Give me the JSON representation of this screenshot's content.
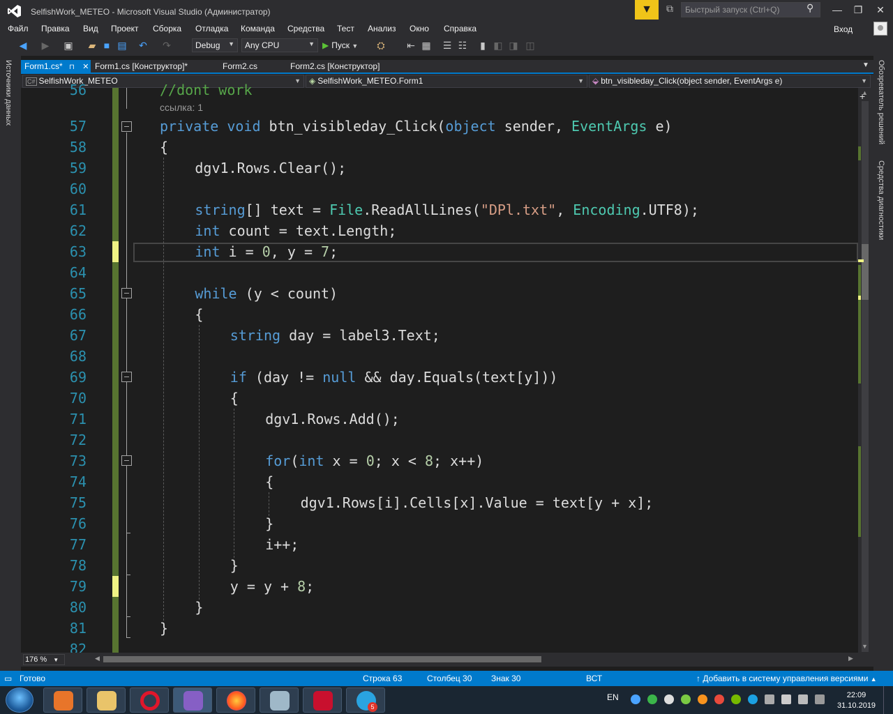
{
  "window": {
    "title": "SelfishWork_METEO - Microsoft Visual Studio  (Администратор)",
    "quick_launch_placeholder": "Быстрый запуск (Ctrl+Q)",
    "sign_in": "Вход"
  },
  "menu": [
    "Файл",
    "Правка",
    "Вид",
    "Проект",
    "Сборка",
    "Отладка",
    "Команда",
    "Средства",
    "Тест",
    "Анализ",
    "Окно",
    "Справка"
  ],
  "toolbar": {
    "config": "Debug",
    "platform": "Any CPU",
    "run": "Пуск"
  },
  "side_panels": {
    "left": "Источники данных",
    "right_top": "Обозреватель решений",
    "right_bottom": "Средства диагностики"
  },
  "tabs": [
    {
      "label": "Form1.cs*",
      "pin": "⊓",
      "close": "✕",
      "active": true
    },
    {
      "label": "Form1.cs [Конструктор]*",
      "active": false
    },
    {
      "label": "Form2.cs",
      "active": false
    },
    {
      "label": "Form2.cs [Конструктор]",
      "active": false
    }
  ],
  "navigation": {
    "project": "SelfishWork_METEO",
    "class": "SelfishWork_METEO.Form1",
    "member": "btn_visibleday_Click(object sender, EventArgs e)"
  },
  "editor": {
    "reference_hint": "ссылка: 1",
    "lines": [
      {
        "n": "56",
        "text": "//dont work"
      },
      {
        "n": "57",
        "text": "private void btn_visibleday_Click(object sender, EventArgs e)"
      },
      {
        "n": "58",
        "text": "{"
      },
      {
        "n": "59",
        "text": "dgv1.Rows.Clear();"
      },
      {
        "n": "60",
        "text": ""
      },
      {
        "n": "61",
        "text": "string[] text = File.ReadAllLines(\"DPl.txt\", Encoding.UTF8);"
      },
      {
        "n": "62",
        "text": "int count = text.Length;"
      },
      {
        "n": "63",
        "text": "int i = 0, y = 7;"
      },
      {
        "n": "64",
        "text": ""
      },
      {
        "n": "65",
        "text": "while (y < count)"
      },
      {
        "n": "66",
        "text": "{"
      },
      {
        "n": "67",
        "text": "string day = label3.Text;"
      },
      {
        "n": "68",
        "text": ""
      },
      {
        "n": "69",
        "text": "if (day != null && day.Equals(text[y]))"
      },
      {
        "n": "70",
        "text": "{"
      },
      {
        "n": "71",
        "text": "dgv1.Rows.Add();"
      },
      {
        "n": "72",
        "text": ""
      },
      {
        "n": "73",
        "text": "for(int x = 0; x < 8; x++)"
      },
      {
        "n": "74",
        "text": "{"
      },
      {
        "n": "75",
        "text": "dgv1.Rows[i].Cells[x].Value = text[y + x];"
      },
      {
        "n": "76",
        "text": "}"
      },
      {
        "n": "77",
        "text": "i++;"
      },
      {
        "n": "78",
        "text": "}"
      },
      {
        "n": "79",
        "text": "y = y + 8;"
      },
      {
        "n": "80",
        "text": "}"
      },
      {
        "n": "81",
        "text": "}"
      },
      {
        "n": "82",
        "text": ""
      }
    ],
    "zoom": "176 %"
  },
  "status": {
    "state": "Готово",
    "line": "Строка 63",
    "column": "Столбец 30",
    "char": "Знак 30",
    "mode": "ВСТ",
    "source_control": "Добавить в систему управления версиями"
  },
  "taskbar": {
    "language": "EN",
    "time": "22:09",
    "date": "31.10.2019",
    "telegram_badge": "5"
  },
  "colors": {
    "keyword": "#569cd6",
    "type": "#4ec9b0",
    "string": "#d69d85",
    "number": "#b5cea8",
    "comment": "#57a64a",
    "accent": "#007acc"
  }
}
